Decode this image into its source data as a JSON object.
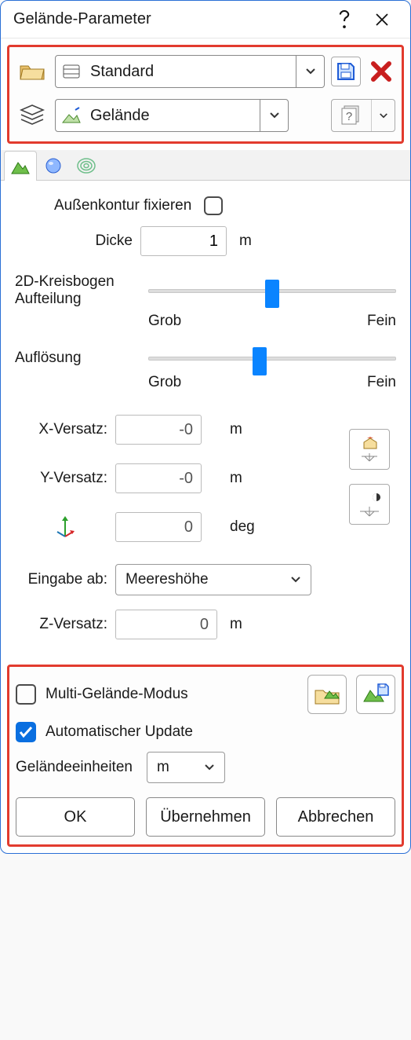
{
  "window": {
    "title": "Gelände-Parameter"
  },
  "top": {
    "preset": "Standard",
    "category": "Gelände"
  },
  "content": {
    "fix_outer_contour_label": "Außenkontur fixieren",
    "fix_outer_contour_checked": false,
    "thickness_label": "Dicke",
    "thickness_value": "1",
    "thickness_unit": "m",
    "arc_label_line1": "2D-Kreisbogen",
    "arc_label_line2": "Aufteilung",
    "coarse_label": "Grob",
    "fine_label": "Fein",
    "resolution_label": "Auflösung",
    "x_offset_label": "X-Versatz:",
    "x_offset_value": "-0",
    "y_offset_label": "Y-Versatz:",
    "y_offset_value": "-0",
    "rotation_value": "0",
    "rotation_unit": "deg",
    "offset_unit": "m",
    "input_from_label": "Eingabe ab:",
    "input_from_value": "Meereshöhe",
    "z_offset_label": "Z-Versatz:",
    "z_offset_value": "0"
  },
  "bottom": {
    "multi_mode_label": "Multi-Gelände-Modus",
    "multi_mode_checked": false,
    "auto_update_label": "Automatischer Update",
    "auto_update_checked": true,
    "units_label": "Geländeeinheiten",
    "units_value": "m",
    "ok_label": "OK",
    "apply_label": "Übernehmen",
    "cancel_label": "Abbrechen"
  },
  "chart_data": {
    "type": "sliders",
    "sliders": [
      {
        "name": "2D-Kreisbogen Aufteilung",
        "range_labels": [
          "Grob",
          "Fein"
        ],
        "position_pct": 50
      },
      {
        "name": "Auflösung",
        "range_labels": [
          "Grob",
          "Fein"
        ],
        "position_pct": 45
      }
    ]
  }
}
